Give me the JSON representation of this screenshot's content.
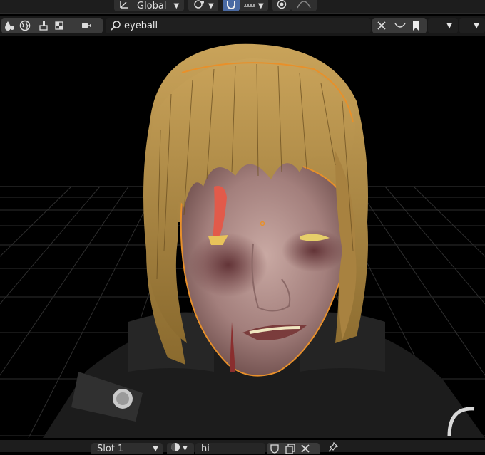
{
  "header": {
    "transform_orientation": "Global",
    "icons": [
      "transform-icon",
      "pivot-icon",
      "snap-magnet-icon",
      "snap-increment-icon",
      "proportional-edit-icon",
      "falloff-curve-icon"
    ]
  },
  "filter_bar": {
    "search_value": "eyeball",
    "left_icons": [
      "drop-icon",
      "world-icon",
      "brush-icon",
      "texture-icon",
      "shader-icon"
    ]
  },
  "viewport": {
    "object": "character-head-with-hair",
    "selection_outline_color": "#e8902a",
    "background_color": "#000000",
    "grid_color": "#3a3a3a"
  },
  "bottom_bar": {
    "slot_label": "Slot 1",
    "material_name": "hi"
  }
}
